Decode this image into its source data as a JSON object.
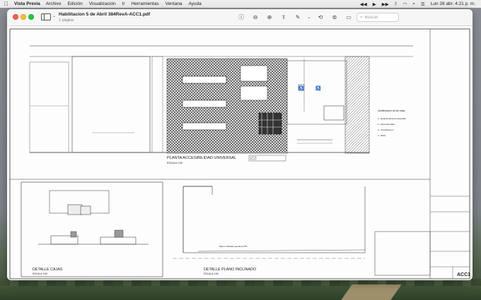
{
  "menubar": {
    "apple": "",
    "app_name": "Vista Previa",
    "items": [
      "Archivo",
      "Edición",
      "Visualización",
      "Ir",
      "Herramientas",
      "Ventana",
      "Ayuda"
    ],
    "clock": "Lun 28 abr.   4:21 p. m."
  },
  "window": {
    "title": "Habilitacion 5 de Abril 384RevA-ACC1.pdf",
    "subtitle": "1 página",
    "search_placeholder": "Buscar"
  },
  "drawing": {
    "main_title": "PLANTA ACCESIBILIDAD UNIVERSAL",
    "main_scale": "ESCALA 1:50",
    "detail_left_title": "DETALLE CAJAS",
    "detail_left_scale": "ESCALA 1:50",
    "detail_right_title": "DETALLE PLANO INCLINADO",
    "detail_right_scale": "ESCALA 1:50",
    "sheet_code": "ACC1",
    "legend_title": "Identificación de las rutas",
    "legend_items": [
      "1.- Estacionamiento accesible",
      "2.- Ruta accesible",
      "3.- Circulaciones",
      "4.- Baño"
    ],
    "ramp_label": "Plano inclinado pendiente 8%"
  },
  "colors": {
    "accent_close": "#fe5f57",
    "accent_min": "#febc2e",
    "accent_max": "#28c840"
  }
}
